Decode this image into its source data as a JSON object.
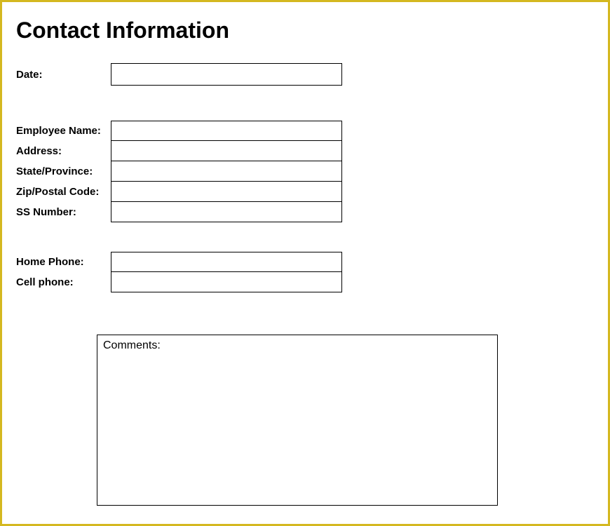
{
  "title": "Contact Information",
  "fields": {
    "date": {
      "label": "Date:",
      "value": ""
    },
    "employeeName": {
      "label": "Employee Name:",
      "value": ""
    },
    "address": {
      "label": "Address:",
      "value": ""
    },
    "stateProvince": {
      "label": "State/Province:",
      "value": ""
    },
    "zipPostal": {
      "label": "Zip/Postal Code:",
      "value": ""
    },
    "ssNumber": {
      "label": "SS Number:",
      "value": ""
    },
    "homePhone": {
      "label": "Home Phone:",
      "value": ""
    },
    "cellPhone": {
      "label": "Cell phone:",
      "value": ""
    },
    "comments": {
      "label": "Comments:",
      "value": ""
    }
  }
}
